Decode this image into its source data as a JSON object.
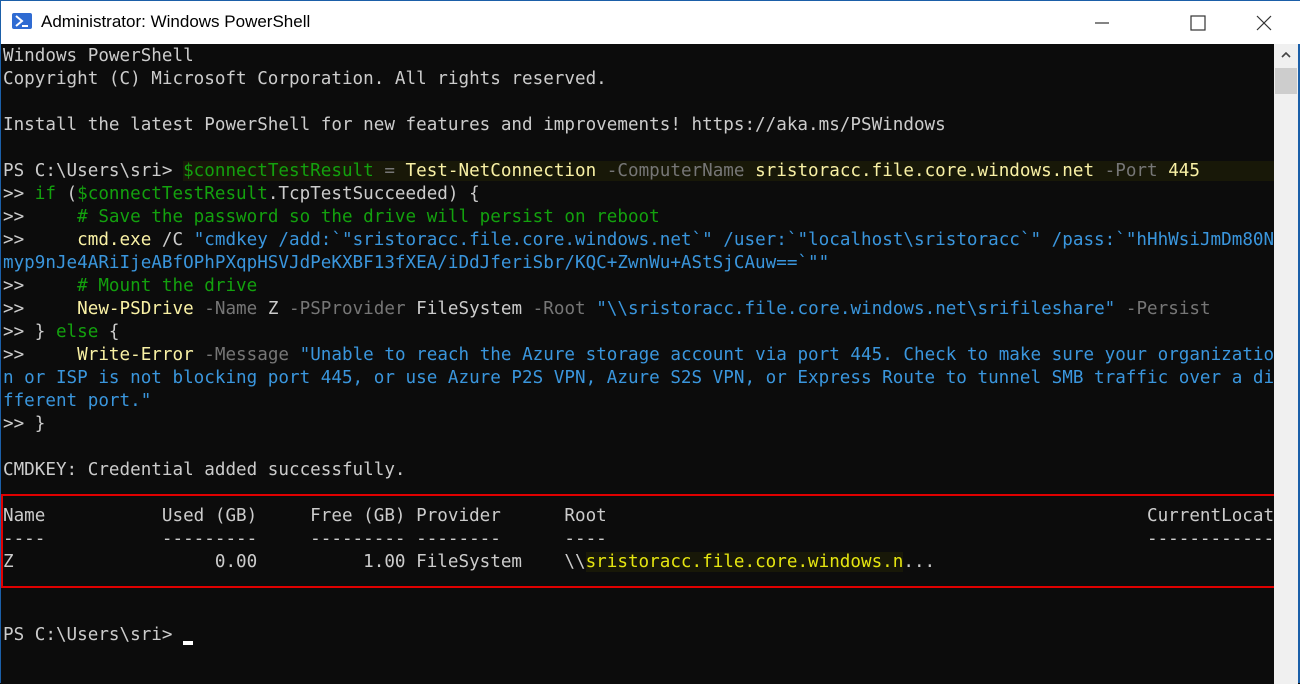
{
  "window": {
    "title": "Administrator: Windows PowerShell",
    "controls": {
      "minimize": "minimize",
      "maximize": "maximize",
      "close": "close"
    }
  },
  "terminal": {
    "banner": {
      "line1": "Windows PowerShell",
      "line2": "Copyright (C) Microsoft Corporation. All rights reserved.",
      "line3": "Install the latest PowerShell for new features and improvements! https://aka.ms/PSWindows"
    },
    "prompt": "PS C:\\Users\\sri> ",
    "cont": ">> ",
    "cont_indent": ">>     ",
    "cmd1": {
      "var": "$connectTestResult",
      "eq": " = ",
      "cmdlet": "Test-NetConnection",
      "p1": " -ComputerName",
      "v1": " sristoracc.file.core.windows.net",
      "p2": " -Port",
      "v2": " 445"
    },
    "cmd2": {
      "kw": "if",
      "open": " (",
      "var": "$connectTestResult",
      "rest": ".TcpTestSucceeded) {"
    },
    "cmd3": {
      "comment": "# Save the password so the drive will persist on reboot"
    },
    "cmd4": {
      "exe": "cmd.exe",
      "arg": " /C ",
      "str1": "\"cmdkey /add:`\"sristoracc.file.core.windows.net`\" /user:`\"localhost\\sristoracc`\" /pass:`\"hHhWsiJmDm80N",
      "str2": "myp9nJe4ARiIjeABfOPhPXqpHSVJdPeKXBF13fXEA/iDdJferiSbr/KQC+ZwnWu+AStSjCAuw==`\"\""
    },
    "cmd5": {
      "comment": "# Mount the drive"
    },
    "cmd6": {
      "cmdlet": "New-PSDrive",
      "p1": " -Name",
      "v1": " Z",
      "p2": " -PSProvider",
      "v2": " FileSystem",
      "p3": " -Root",
      "v3": " \"\\\\sristoracc.file.core.windows.net\\srifileshare\"",
      "p4": " -Persist"
    },
    "cmd7": {
      "brace": "} ",
      "kw": "else",
      "rest": " {"
    },
    "cmd8": {
      "cmdlet": "Write-Error",
      "p1": " -Message",
      "str1": " \"Unable to reach the Azure storage account via port 445. Check to make sure your organizatio",
      "str2": "n or ISP is not blocking port 445, or use Azure P2S VPN, Azure S2S VPN, or Express Route to tunnel SMB traffic over a di",
      "str3": "fferent port.\""
    },
    "cmd9": {
      "brace": "}"
    },
    "output_cmdkey": "CMDKEY: Credential added successfully.",
    "table": {
      "headers": [
        "Name",
        "Used (GB)",
        "Free (GB)",
        "Provider",
        "Root",
        "CurrentLocation"
      ],
      "header_line": "Name           Used (GB)     Free (GB) Provider      Root                                                   CurrentLocation",
      "sep_line": "----           ---------     --------- --------      ----                                                   ---------------",
      "rows": [
        {
          "name": "Z",
          "used": "0.00",
          "free": "1.00",
          "provider": "FileSystem",
          "root_prefix": "\\\\",
          "root": "sristoracc.file.core.windows.n",
          "root_suffix": "...",
          "current_location": ""
        }
      ],
      "row_prefix": "Z                   0.00          1.00 FileSystem    "
    },
    "final_prompt": "PS C:\\Users\\sri> "
  },
  "colors": {
    "background": "#0c0c0c",
    "foreground": "#cccccc",
    "variable": "#13a10e",
    "cmdlet": "#f9f1a5",
    "parameter": "#767676",
    "string": "#3a96dd",
    "comment": "#13a10e",
    "highlight_box": "#e00000"
  }
}
